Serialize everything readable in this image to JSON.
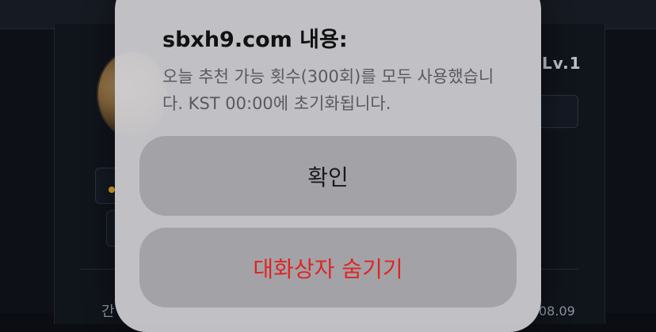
{
  "background": {
    "level_label": "Lv.1",
    "bottom_left_text": "간",
    "bottom_right_text": "08.09"
  },
  "dialog": {
    "title": "sbxh9.com 내용:",
    "message": "오늘 추천 가능 횟수(300회)를 모두 사용했습니다. KST 00:00에 초기화됩니다.",
    "confirm_label": "확인",
    "hide_label": "대화상자 숨기기"
  },
  "colors": {
    "dialog_bg": "#cecec2",
    "button_bg": "#a3a3a7",
    "destructive": "#e02424",
    "page_bg": "#0d1016"
  }
}
